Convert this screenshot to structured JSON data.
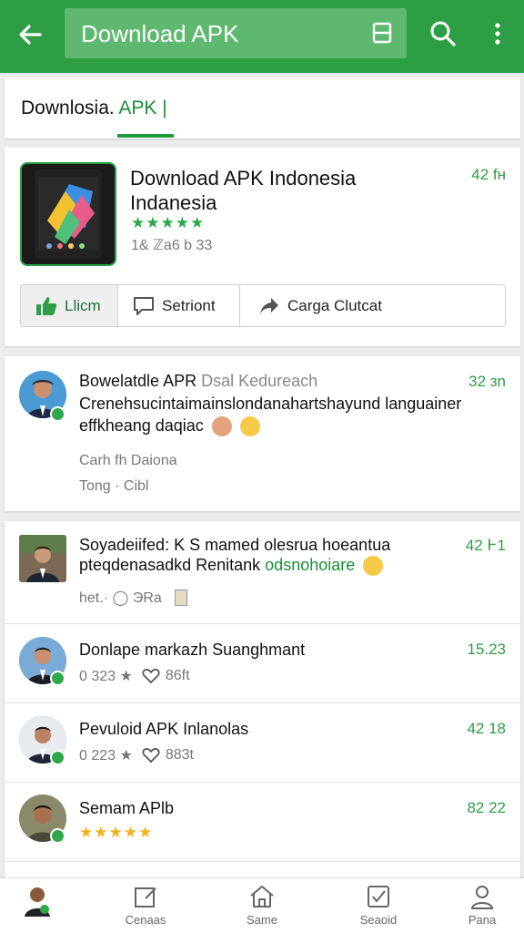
{
  "topbar": {
    "search_text": "Download APK"
  },
  "tab": {
    "label_prefix": "Downlosia.",
    "label_highlight": "APK"
  },
  "app": {
    "title_line1": "Download APK Indonesia",
    "title_line2": "Indanesia",
    "stars": "★★★★★",
    "meta": "1& ℤa6 b 33",
    "time": "42 fн",
    "like_label": "Llicm",
    "share_label": "Setriont",
    "save_label": "Carga Clutcat"
  },
  "post": {
    "title": "Bowelatdle APR",
    "title_muted": "Dsal Kedureach",
    "time": "32 зn",
    "body_line1": "Crenehsucintaimainslondanahartshayund languainer",
    "body_line2": "effkheang daqiac",
    "footer_line1": "Carh fh Daiona",
    "footer_line2": "Tong · Cibl"
  },
  "feed": [
    {
      "title": "Soyadeiifed: K S mamed olesrua hoeantua",
      "line2_a": "pteqdenasadkd Renitank",
      "line2_b": "odsnohoiare",
      "meta": "het.· ◯ ЭRa",
      "time": "42 Ͱ1"
    },
    {
      "title": "Donlape markazh Suanghmant",
      "meta_text": "0 323 ★",
      "meta_count": "86ft",
      "time": "15.23"
    },
    {
      "title": "Pevuloid APK Inlanolas",
      "meta_text": "0 223 ★",
      "meta_count": "883t",
      "time": "42 18"
    },
    {
      "title": "Semam APlb",
      "stars": "★★★★★",
      "time": "82 22"
    }
  ],
  "bottomnav": {
    "items": [
      "Cenaas",
      "Same",
      "Seaoid",
      "Pana"
    ]
  },
  "colors": {
    "primary": "#2e9e45",
    "accent_text": "#1a8f35"
  }
}
